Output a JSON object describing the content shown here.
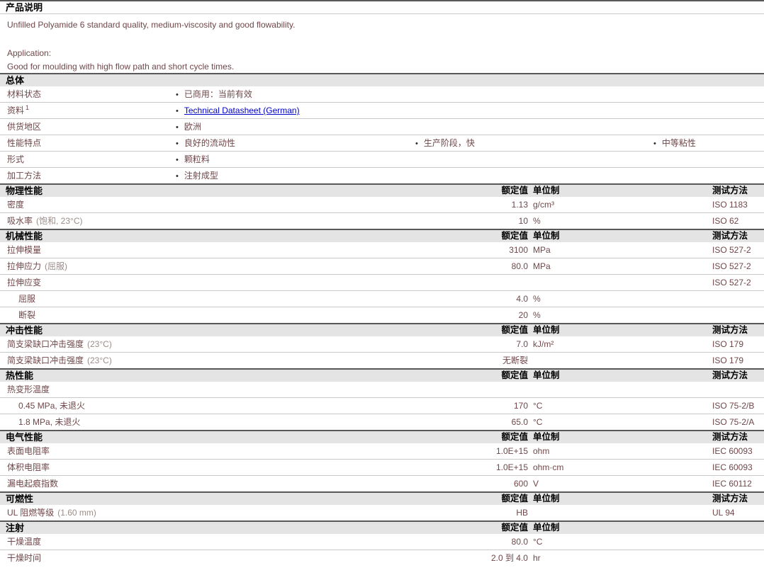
{
  "bullet_char": "•",
  "colors": {
    "body_text": "#70474a",
    "note_text": "#9b8d88",
    "header_text": "#000000",
    "link": "#0000cc",
    "bullet": "#2b2b2b",
    "section_bg": "#e4e4e4",
    "section_border": "#58585a",
    "row_border": "#c9c9c9"
  },
  "columns": {
    "value_header": "额定值",
    "unit_header": "单位制",
    "method_header": "测试方法"
  },
  "product_description": {
    "header": "产品说明",
    "text": "Unfilled Polyamide 6 standard quality, medium-viscosity and good flowability.",
    "application_label": "Application:",
    "application_text": "Good for moulding with high flow path and short cycle times."
  },
  "sections": [
    {
      "id": "general",
      "header": "总体",
      "type": "list",
      "rows": [
        {
          "label": "材料状态",
          "bullets": [
            "已商用：当前有效"
          ]
        },
        {
          "label": "资料",
          "sup": "1",
          "link": "Technical Datasheet (German)"
        },
        {
          "label": "供货地区",
          "bullets": [
            "欧洲"
          ]
        },
        {
          "label": "性能特点",
          "bullets": [
            "良好的流动性",
            "生产阶段，快",
            "中等粘性"
          ]
        },
        {
          "label": "形式",
          "bullets": [
            "颗粒料"
          ]
        },
        {
          "label": "加工方法",
          "bullets": [
            "注射成型"
          ]
        }
      ]
    },
    {
      "id": "physical",
      "header": "物理性能",
      "type": "props",
      "show_method": true,
      "rows": [
        {
          "label": "密度",
          "value": "1.13",
          "unit": "g/cm³",
          "method": "ISO 1183"
        },
        {
          "label": "吸水率",
          "note": "(饱和, 23°C)",
          "value": "10",
          "unit": "%",
          "method": "ISO 62"
        }
      ]
    },
    {
      "id": "mechanical",
      "header": "机械性能",
      "type": "props",
      "show_method": true,
      "rows": [
        {
          "label": "拉伸模量",
          "value": "3100",
          "unit": "MPa",
          "method": "ISO 527-2"
        },
        {
          "label": "拉伸应力",
          "note": "(屈服)",
          "value": "80.0",
          "unit": "MPa",
          "method": "ISO 527-2"
        },
        {
          "label": "拉伸应变",
          "method": "ISO 527-2"
        },
        {
          "label": "屈服",
          "indent": true,
          "value": "4.0",
          "unit": "%"
        },
        {
          "label": "断裂",
          "indent": true,
          "value": "20",
          "unit": "%"
        }
      ]
    },
    {
      "id": "impact",
      "header": "冲击性能",
      "type": "props",
      "show_method": true,
      "rows": [
        {
          "label": "简支梁缺口冲击强度",
          "note": "(23°C)",
          "value": "7.0",
          "unit": "kJ/m²",
          "method": "ISO 179"
        },
        {
          "label": "简支梁缺口冲击强度",
          "note": "(23°C)",
          "value": "无断裂",
          "method": "ISO 179"
        }
      ]
    },
    {
      "id": "thermal",
      "header": "热性能",
      "type": "props",
      "show_method": true,
      "rows": [
        {
          "label": "热变形温度"
        },
        {
          "label": "0.45 MPa, 未退火",
          "indent": true,
          "value": "170",
          "unit": "°C",
          "method": "ISO 75-2/B"
        },
        {
          "label": "1.8 MPa, 未退火",
          "indent": true,
          "value": "65.0",
          "unit": "°C",
          "method": "ISO 75-2/A"
        }
      ]
    },
    {
      "id": "electrical",
      "header": "电气性能",
      "type": "props",
      "show_method": true,
      "rows": [
        {
          "label": "表面电阻率",
          "value": "1.0E+15",
          "unit": "ohm",
          "method": "IEC 60093"
        },
        {
          "label": "体积电阻率",
          "value": "1.0E+15",
          "unit": "ohm·cm",
          "method": "IEC 60093"
        },
        {
          "label": "漏电起痕指数",
          "value": "600",
          "unit": "V",
          "method": "IEC 60112"
        }
      ]
    },
    {
      "id": "flammability",
      "header": "可燃性",
      "type": "props",
      "show_method": true,
      "rows": [
        {
          "label": "UL 阻燃等级",
          "note": "(1.60 mm)",
          "value": "HB",
          "method": "UL 94"
        }
      ]
    },
    {
      "id": "injection",
      "header": "注射",
      "type": "props",
      "show_method": false,
      "rows": [
        {
          "label": "干燥温度",
          "value": "80.0",
          "unit": "°C"
        },
        {
          "label": "干燥时间",
          "value": "2.0 到 4.0",
          "unit": "hr"
        }
      ]
    }
  ]
}
